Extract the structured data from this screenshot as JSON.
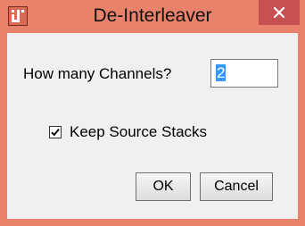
{
  "window": {
    "title": "De-Interleaver",
    "close_symbol": "✕",
    "app_icon": "imagej-icon",
    "titlebar_color": "#e9826a",
    "close_button_color": "#c75050"
  },
  "form": {
    "channels_label": "How many Channels?",
    "channels_value": "2",
    "keep_source_label": "Keep Source Stacks",
    "keep_source_checked": true
  },
  "buttons": {
    "ok_label": "OK",
    "cancel_label": "Cancel"
  }
}
